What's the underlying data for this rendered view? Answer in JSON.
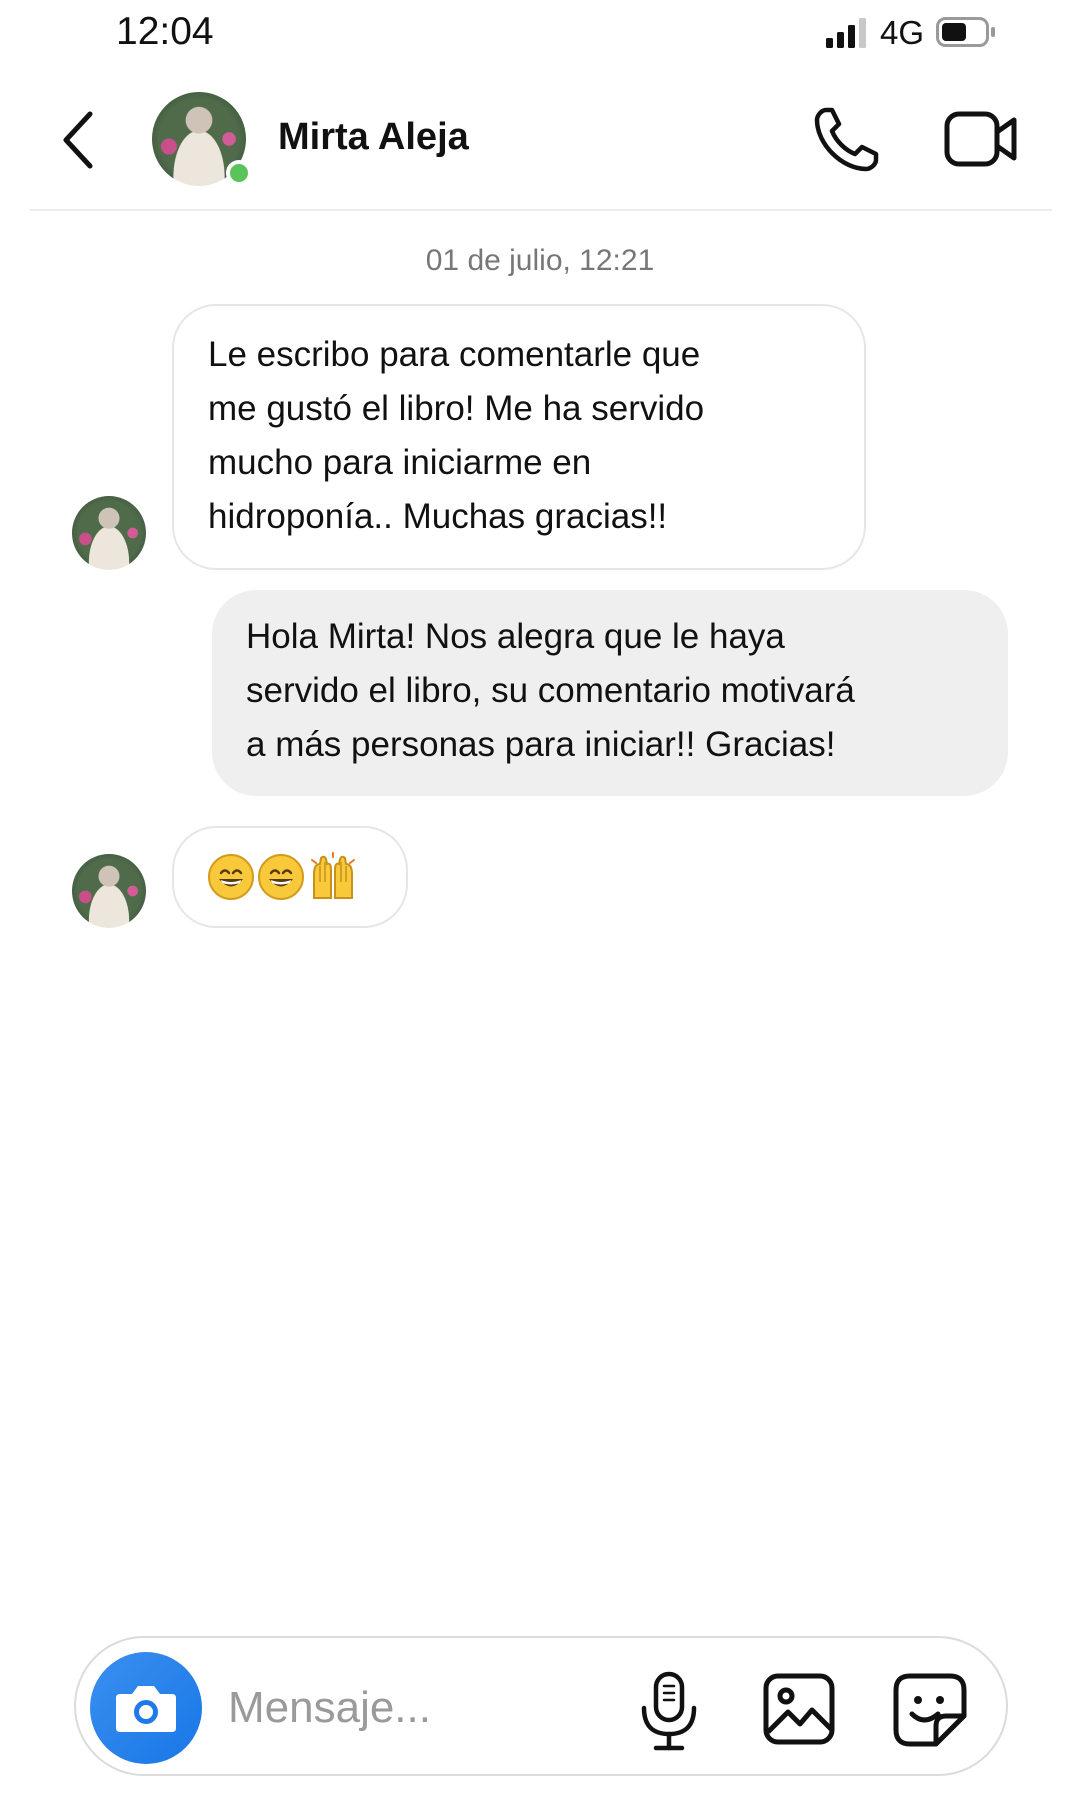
{
  "status_bar": {
    "time": "12:04",
    "network": "4G",
    "signal_icon": "signal-bars-icon",
    "battery_icon": "battery-icon"
  },
  "header": {
    "contact_name": "Mirta Aleja",
    "online": true,
    "back_icon": "chevron-left-icon",
    "call_icon": "phone-icon",
    "video_icon": "video-camera-icon"
  },
  "conversation": {
    "date_stamp": "01 de julio, 12:21",
    "messages": [
      {
        "direction": "incoming",
        "lines": [
          "Le escribo para comentarle que",
          "me gustó el libro! Me ha servido",
          "mucho para iniciarme en",
          "hidroponía.. Muchas gracias!!"
        ]
      },
      {
        "direction": "outgoing",
        "lines": [
          "Hola Mirta! Nos alegra que le haya",
          "servido el libro, su comentario motivará",
          "a más personas para iniciar!! Gracias!"
        ]
      },
      {
        "direction": "incoming",
        "emoji": [
          "grinning-face",
          "grinning-face",
          "raising-hands"
        ]
      }
    ]
  },
  "composer": {
    "placeholder": "Mensaje...",
    "value": "",
    "camera_icon": "camera-icon",
    "mic_icon": "microphone-icon",
    "gallery_icon": "image-icon",
    "sticker_icon": "sticker-icon"
  },
  "colors": {
    "online_dot": "#5ac45a",
    "camera_button": "#1877e6",
    "outgoing_bubble": "#efefef",
    "incoming_border": "#e6e6e6"
  }
}
